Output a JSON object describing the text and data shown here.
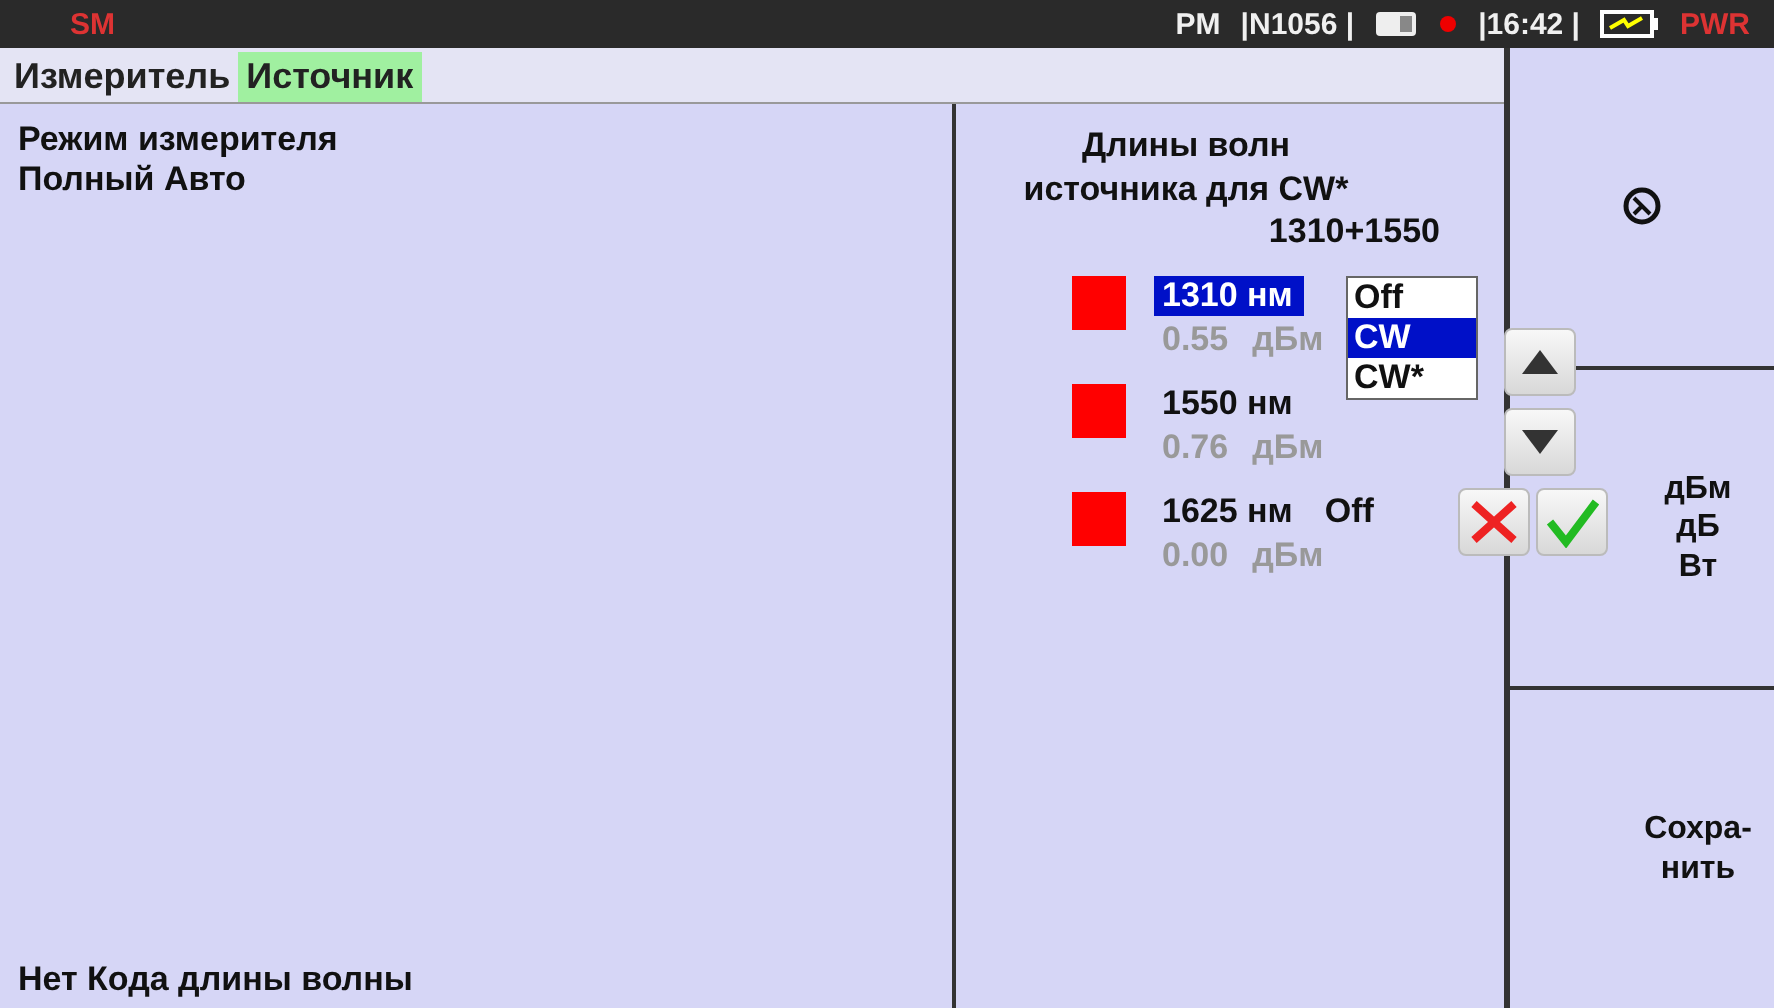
{
  "status_bar": [
    {
      "kind": "alert",
      "text": "SM"
    },
    {
      "kind": "spacer"
    },
    {
      "kind": "text",
      "text": "PM"
    },
    {
      "kind": "text",
      "text": "|N1056 |"
    },
    {
      "kind": "card"
    },
    {
      "kind": "dot"
    },
    {
      "kind": "text",
      "text": "|16:42 |"
    },
    {
      "kind": "battery"
    },
    {
      "kind": "alert",
      "text": "PWR"
    }
  ],
  "tabs": [
    {
      "label": "Измеритель",
      "selected": false
    },
    {
      "label": "Источник",
      "selected": true
    }
  ],
  "meter": {
    "mode_label": "Режим измерителя",
    "mode_value": "Полный Авто",
    "footer": "Нет Кода длины волны"
  },
  "source": {
    "title": "Длины волн источника для CW*",
    "combo": "1310+1550",
    "wavelengths": [
      {
        "name": "1310 нм",
        "power": "0.55",
        "unit": "дБм",
        "selected": true
      },
      {
        "name": "1550 нм",
        "power": "0.76",
        "unit": "дБм",
        "selected": false
      },
      {
        "name": "1625 нм",
        "state": "Off",
        "power": "0.00",
        "unit": "дБм",
        "selected": false
      }
    ],
    "dropdown": [
      {
        "label": "Off",
        "selected": false
      },
      {
        "label": "CW",
        "selected": true
      },
      {
        "label": "CW*",
        "selected": false
      }
    ]
  },
  "side_buttons": [
    {
      "kind": "icon"
    },
    {
      "kind": "lines",
      "lines": [
        "дБм",
        "дБ",
        "Вт"
      ]
    },
    {
      "kind": "lines",
      "lines": [
        "Сохра-",
        "нить"
      ]
    }
  ]
}
